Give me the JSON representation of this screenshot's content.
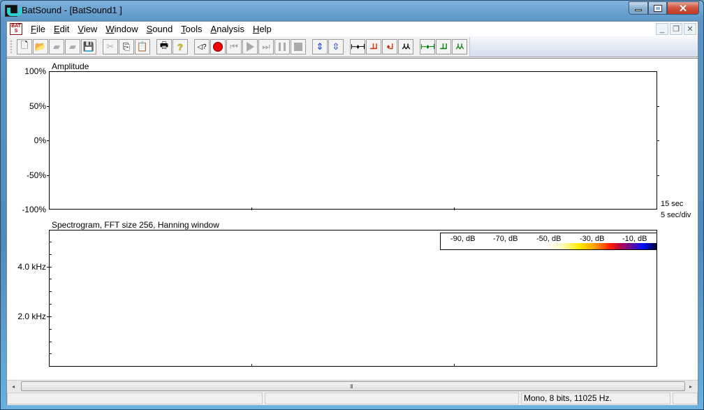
{
  "window": {
    "title": "BatSound - [BatSound1 ]",
    "caption_buttons": [
      "minimize",
      "maximize",
      "close"
    ]
  },
  "menubar": {
    "items": [
      {
        "label": "File",
        "mnemonic": "F"
      },
      {
        "label": "Edit",
        "mnemonic": "E"
      },
      {
        "label": "View",
        "mnemonic": "V"
      },
      {
        "label": "Window",
        "mnemonic": "W"
      },
      {
        "label": "Sound",
        "mnemonic": "S"
      },
      {
        "label": "Tools",
        "mnemonic": "T"
      },
      {
        "label": "Analysis",
        "mnemonic": "A"
      },
      {
        "label": "Help",
        "mnemonic": "H"
      }
    ],
    "mdi_buttons": [
      "minimize",
      "restore",
      "close"
    ]
  },
  "toolbar": {
    "groups": [
      [
        "new-file",
        "open-file",
        "import-disabled",
        "export-disabled",
        "save"
      ],
      [
        "cut-disabled",
        "copy",
        "paste"
      ],
      [
        "print",
        "help"
      ],
      [
        "speaker-query",
        "record",
        "rewind-disabled",
        "play-disabled",
        "fast-forward-disabled",
        "pause-disabled",
        "stop-disabled"
      ],
      [
        "zoom-in-amplitude",
        "zoom-out-amplitude"
      ],
      [
        "oscillogram",
        "spectrogram",
        "spectrogram-overlay",
        "power-spectrum"
      ],
      [
        "oscillogram-green",
        "spectrogram-green",
        "power-spectrum-green"
      ]
    ]
  },
  "amplitude_panel": {
    "title": "Amplitude",
    "y_ticks": [
      "100%",
      "50%",
      "0%",
      "-50%",
      "-100%"
    ],
    "time_total": "15 sec",
    "time_div": "5 sec/div"
  },
  "spectrogram_panel": {
    "title": "Spectrogram, FFT size 256, Hanning window",
    "y_ticks": [
      "4.0 kHz",
      "2.0 kHz"
    ],
    "legend": {
      "labels": [
        "-90, dB",
        "-70, dB",
        "-50, dB",
        "-30, dB",
        "-10, dB"
      ],
      "colors": [
        "#ffffff",
        "#ffee00",
        "#ff9a00",
        "#ff2000",
        "#b00050",
        "#6010a0",
        "#0010ff",
        "#000030"
      ]
    }
  },
  "scrollbar": {
    "left_arrow": "◂",
    "right_arrow": "▸",
    "grip": "III"
  },
  "statusbar": {
    "pane1": "",
    "pane2": "",
    "pane3": "Mono, 8 bits, 11025 Hz.",
    "pane4": ""
  }
}
